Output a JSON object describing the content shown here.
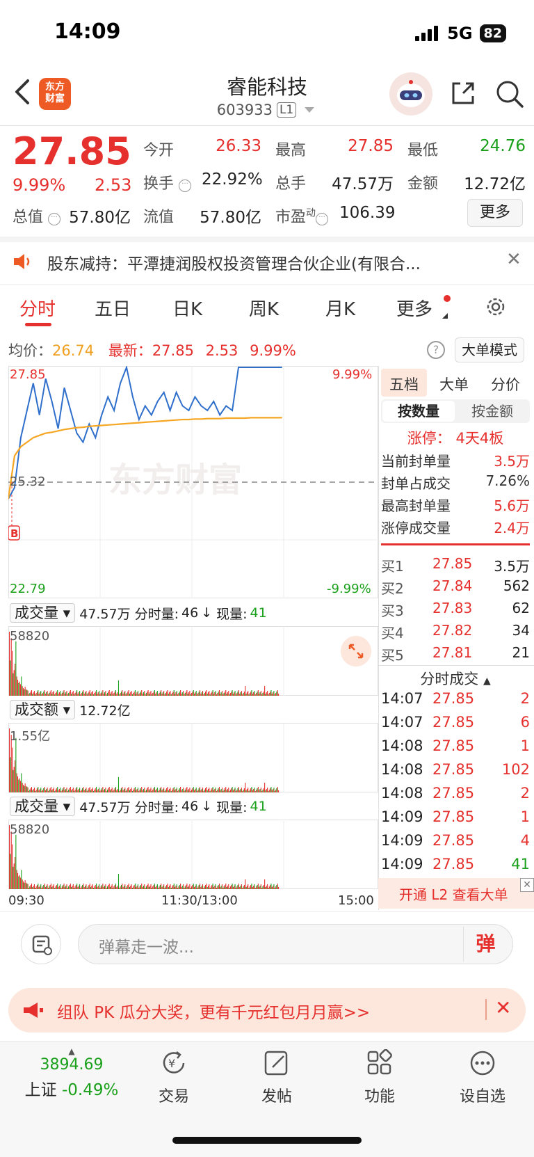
{
  "status_bar": {
    "time": "14:09",
    "network": "5G",
    "battery": "82"
  },
  "header": {
    "logo_line1": "东方",
    "logo_line2": "财富",
    "stock_name": "睿能科技",
    "stock_code": "603933",
    "level_badge": "L1"
  },
  "quote": {
    "price": "27.85",
    "change_pct": "9.99%",
    "change": "2.53",
    "open_label": "今开",
    "open": "26.33",
    "high_label": "最高",
    "high": "27.85",
    "low_label": "最低",
    "low": "24.76",
    "turnover_label": "换手",
    "turnover": "22.92%",
    "volume_label": "总手",
    "volume": "47.57万",
    "amount_label": "金额",
    "amount": "12.72亿",
    "mktcap_label": "总值",
    "mktcap": "57.80亿",
    "float_label": "流值",
    "float": "57.80亿",
    "pe_label": "市盈",
    "pe_sup": "动",
    "pe": "106.39",
    "more_button": "更多"
  },
  "notice": {
    "text": "股东减持：平潭捷润股权投资管理合伙企业(有限合..."
  },
  "tabs": [
    "分时",
    "五日",
    "日K",
    "周K",
    "月K",
    "更多"
  ],
  "chart_header": {
    "avg_label": "均价：",
    "avg": "26.74",
    "latest_label": "最新：",
    "latest": "27.85",
    "change": "2.53",
    "change_pct": "9.99%",
    "mode_button": "大单模式"
  },
  "chart_data": {
    "type": "line",
    "x_ticks": [
      "09:30",
      "11:30/13:00",
      "15:00"
    ],
    "ylim": [
      22.79,
      27.85
    ],
    "y_left_labels": [
      "27.85",
      "25.32",
      "22.79"
    ],
    "y_right_labels": [
      "9.99%",
      "-9.99%"
    ],
    "reference_price": 25.32,
    "marker": "B",
    "watermark": "东方财富",
    "series": [
      {
        "name": "price",
        "values": [
          24.95,
          25.2,
          26.3,
          26.9,
          27.5,
          26.8,
          27.6,
          27.1,
          26.5,
          27.4,
          26.9,
          26.4,
          26.2,
          26.6,
          26.3,
          26.8,
          27.2,
          26.9,
          27.5,
          27.85,
          27.2,
          26.7,
          27.0,
          26.8,
          27.1,
          27.3,
          26.9,
          27.3,
          27.0,
          26.9,
          27.2,
          27.0,
          26.9,
          27.1,
          26.8,
          27.0,
          26.9,
          27.85,
          27.85,
          27.85,
          27.85,
          27.85,
          27.85,
          27.85,
          27.85
        ]
      },
      {
        "name": "avg",
        "values": [
          24.95,
          25.9,
          26.1,
          26.2,
          26.3,
          26.35,
          26.4,
          26.42,
          26.45,
          26.48,
          26.5,
          26.52,
          26.53,
          26.55,
          26.56,
          26.57,
          26.58,
          26.59,
          26.6,
          26.61,
          26.62,
          26.63,
          26.64,
          26.65,
          26.66,
          26.67,
          26.68,
          26.69,
          26.7,
          26.7,
          26.71,
          26.71,
          26.72,
          26.72,
          26.72,
          26.73,
          26.73,
          26.73,
          26.73,
          26.74,
          26.74,
          26.74,
          26.74,
          26.74,
          26.74
        ]
      }
    ],
    "volume_panels": [
      {
        "selector": "成交量",
        "total": "47.57万",
        "fenshi_label": "分时量:",
        "fenshi": "46",
        "arrow": "↓",
        "now_label": "现量:",
        "now": "41",
        "max": "58820"
      },
      {
        "selector": "成交额",
        "total": "12.72亿",
        "max": "1.55亿"
      },
      {
        "selector": "成交量",
        "total": "47.57万",
        "fenshi_label": "分时量:",
        "fenshi": "46",
        "arrow": "↓",
        "now_label": "现量:",
        "now": "41",
        "max": "58820"
      }
    ]
  },
  "right_panel": {
    "tabs": [
      "五档",
      "大单",
      "分价"
    ],
    "sub_tabs": [
      "按数量",
      "按金额"
    ],
    "limit_up": "涨停： 4天4板",
    "stats": [
      {
        "label": "当前封单量",
        "value": "3.5万",
        "color": "#e5302d"
      },
      {
        "label": "封单占成交",
        "value": "7.26%",
        "color": "#333333"
      },
      {
        "label": "最高封单量",
        "value": "5.6万",
        "color": "#e5302d"
      },
      {
        "label": "涨停成交量",
        "value": "2.4万",
        "color": "#e5302d"
      }
    ],
    "bids": [
      {
        "label": "买1",
        "price": "27.85",
        "qty": "3.5万"
      },
      {
        "label": "买2",
        "price": "27.84",
        "qty": "562"
      },
      {
        "label": "买3",
        "price": "27.83",
        "qty": "62"
      },
      {
        "label": "买4",
        "price": "27.82",
        "qty": "34"
      },
      {
        "label": "买5",
        "price": "27.81",
        "qty": "21"
      }
    ],
    "trades_title": "分时成交",
    "trades": [
      {
        "time": "14:07",
        "price": "27.85",
        "qty": "2"
      },
      {
        "time": "14:07",
        "price": "27.85",
        "qty": "6"
      },
      {
        "time": "14:08",
        "price": "27.85",
        "qty": "1"
      },
      {
        "time": "14:08",
        "price": "27.85",
        "qty": "102"
      },
      {
        "time": "14:08",
        "price": "27.85",
        "qty": "2"
      },
      {
        "time": "14:09",
        "price": "27.85",
        "qty": "1"
      },
      {
        "time": "14:09",
        "price": "27.85",
        "qty": "4"
      },
      {
        "time": "14:09",
        "price": "27.85",
        "qty": "41"
      }
    ],
    "l2_banner": "开通 L2 查看大单"
  },
  "danmaku": {
    "placeholder": "弹幕走一波...",
    "send": "弹"
  },
  "promo": {
    "text": "组队 PK 瓜分大奖，更有千元红包月月赢>>"
  },
  "bottom_nav": {
    "index_value": "3894.69",
    "index_name": "上证",
    "index_change": "-0.49%",
    "items": [
      "交易",
      "发帖",
      "功能",
      "设自选"
    ]
  }
}
